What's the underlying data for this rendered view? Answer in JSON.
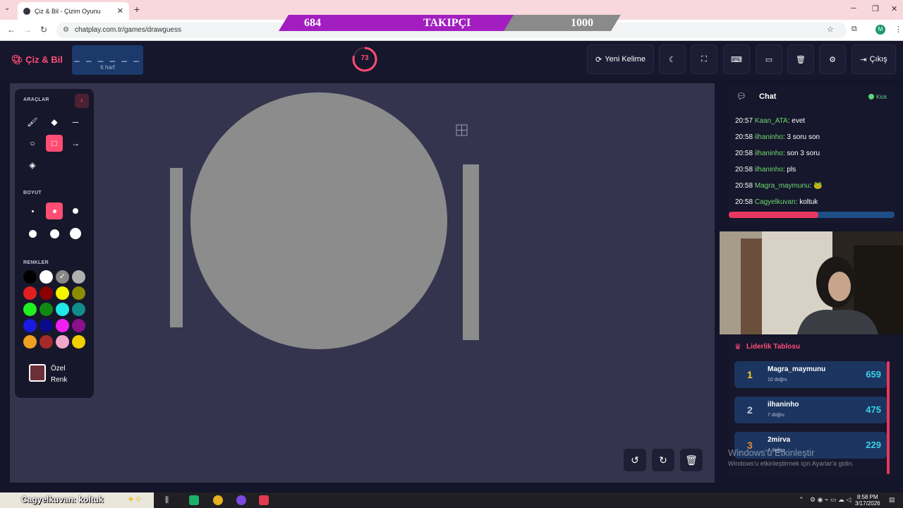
{
  "browser": {
    "tab_title": "Çiz & Bil - Çizim Oyunu",
    "url": "chatplay.com.tr/games/drawguess",
    "profile_initial": "M"
  },
  "banner": {
    "current": "684",
    "label": "TAKIPÇI",
    "goal": "1000"
  },
  "header": {
    "logo": "Çiz & Bil",
    "word_blanks": "_ _ _ _ _ _",
    "word_hint": "6 harf",
    "timer": "73",
    "new_word": "Yeni Kelime",
    "exit": "Çıkış"
  },
  "toolbox": {
    "tools_heading": "ARAÇLAR",
    "size_heading": "BOYUT",
    "colors_heading": "RENKLER",
    "custom_color_label": "Özel Renk"
  },
  "colors": {
    "accent": "#ff4d74",
    "palette": [
      "#000000",
      "#ffffff",
      "#888888",
      "#b0b0b0",
      "#e02020",
      "#8b0000",
      "#f5f500",
      "#8b8b00",
      "#20f020",
      "#118811",
      "#20e8e8",
      "#118b8b",
      "#1a1ae0",
      "#0a0a8a",
      "#f020f0",
      "#8b108b",
      "#f0a020",
      "#a52a2a",
      "#f0a8c8",
      "#f0d000"
    ],
    "custom": "#6b2f37"
  },
  "chat": {
    "title": "Chat",
    "status": "Kick",
    "messages": [
      {
        "time": "20:57",
        "user": "Kaan_ATA",
        "text": "evet"
      },
      {
        "time": "20:58",
        "user": "ilhaninho",
        "text": "3 soru son"
      },
      {
        "time": "20:58",
        "user": "ilhaninho",
        "text": "son 3 soru"
      },
      {
        "time": "20:58",
        "user": "ilhaninho",
        "text": "pls"
      },
      {
        "time": "20:58",
        "user": "Magra_maymunu",
        "text": "🐸"
      },
      {
        "time": "20:58",
        "user": "Cagyelkuvan",
        "text": "koltuk"
      }
    ],
    "scroll_progress": 0.54
  },
  "leaderboard": {
    "title": "Liderlik Tablosu",
    "rows": [
      {
        "rank": "1",
        "name": "Magra_maymunu",
        "sub": "10 doğru",
        "score": "659"
      },
      {
        "rank": "2",
        "name": "ilhaninho",
        "sub": "7 doğru",
        "score": "475"
      },
      {
        "rank": "3",
        "name": "2mirva",
        "sub": "4 doğru",
        "score": "229"
      }
    ]
  },
  "watermark": {
    "line1": "Windows'u Etkinleştir",
    "line2": "Windows'u etkinleştirmek için Ayarlar'a gidin."
  },
  "taskbar": {
    "stream_text": "Cagyelkuvan: koltuk",
    "time": "8:58 PM",
    "date": "3/17/2026"
  }
}
